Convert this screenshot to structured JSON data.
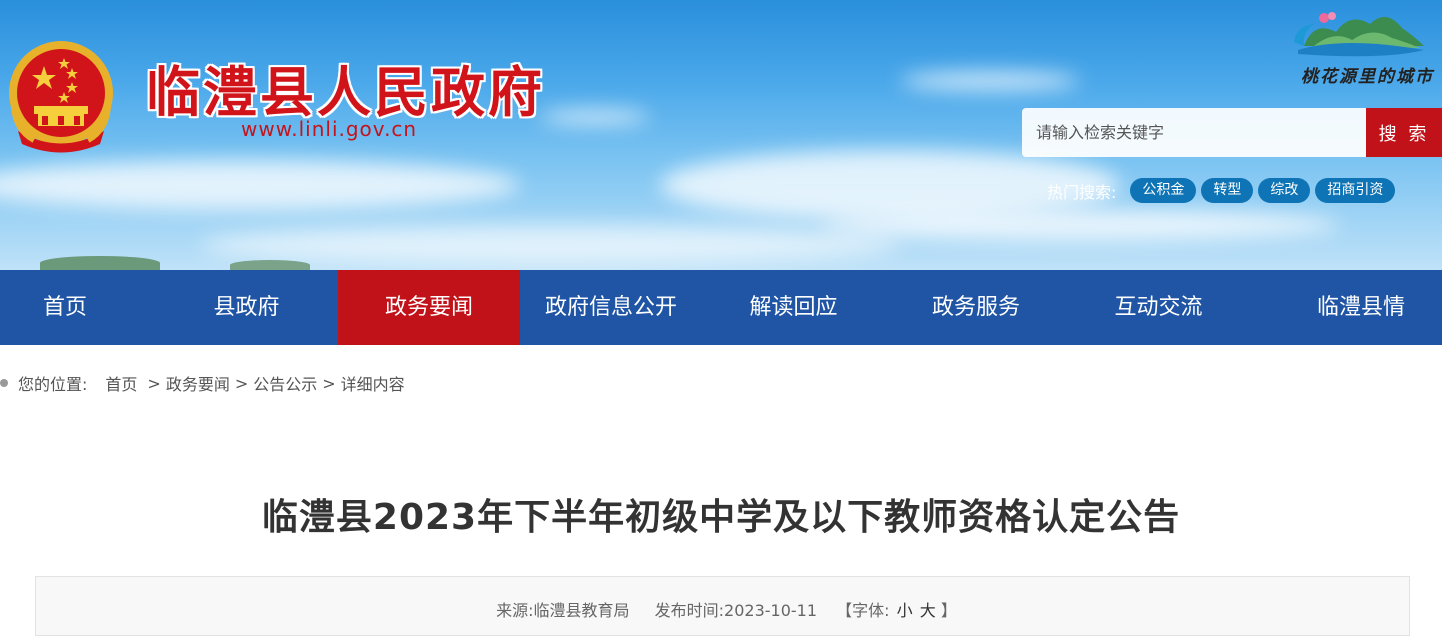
{
  "header": {
    "site_title": "临澧县人民政府",
    "site_url": "www.linli.gov.cn",
    "city_slogan": "桃花源里的城市",
    "search": {
      "placeholder": "请输入检索关键字",
      "button_label": "搜 索"
    },
    "hot_search": {
      "label": "热门搜索:",
      "tags": [
        "公积金",
        "转型",
        "综改",
        "招商引资"
      ]
    }
  },
  "nav": {
    "items": [
      {
        "label": "首页"
      },
      {
        "label": "县政府"
      },
      {
        "label": "政务要闻"
      },
      {
        "label": "政府信息公开"
      },
      {
        "label": "解读回应"
      },
      {
        "label": "政务服务"
      },
      {
        "label": "互动交流"
      },
      {
        "label": "临澧县情"
      }
    ],
    "active_index": 2
  },
  "breadcrumb": {
    "label": "您的位置:",
    "items": [
      "首页",
      "政务要闻",
      "公告公示",
      "详细内容"
    ],
    "separator": ">"
  },
  "article": {
    "title": "临澧县2023年下半年初级中学及以下教师资格认定公告",
    "source_label": "来源:",
    "source_value": "临澧县教育局",
    "date_label": "发布时间:",
    "date_value": "2023-10-11",
    "font_label_open": "【字体:",
    "font_small": "小",
    "font_large": "大",
    "font_label_close": "】"
  },
  "colors": {
    "brand_red": "#c1121a",
    "nav_blue": "#1f55a4",
    "tag_blue": "#0f74b5"
  }
}
